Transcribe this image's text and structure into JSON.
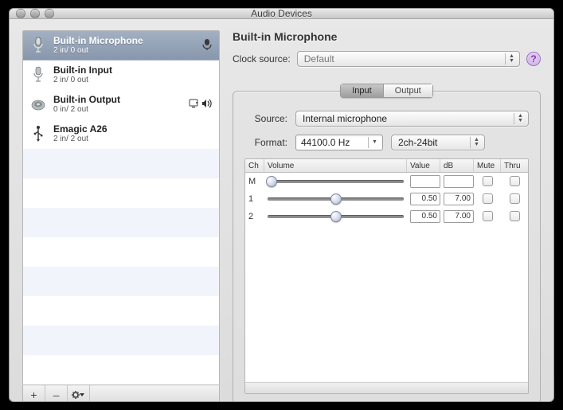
{
  "window": {
    "title": "Audio Devices"
  },
  "sidebar": {
    "devices": [
      {
        "name": "Built-in Microphone",
        "sub": "2 in/ 0 out",
        "icon": "mic",
        "selected": true,
        "badges": [
          "mic"
        ]
      },
      {
        "name": "Built-in Input",
        "sub": "2 in/ 0 out",
        "icon": "mic",
        "selected": false,
        "badges": []
      },
      {
        "name": "Built-in Output",
        "sub": "0 in/ 2 out",
        "icon": "speaker",
        "selected": false,
        "badges": [
          "system",
          "sound"
        ]
      },
      {
        "name": "Emagic A26",
        "sub": "2 in/ 2 out",
        "icon": "usb",
        "selected": false,
        "badges": []
      }
    ],
    "buttons": {
      "add": "+",
      "remove": "–",
      "gear": "✻▾"
    }
  },
  "detail": {
    "title": "Built-in Microphone",
    "clock_label": "Clock source:",
    "clock_value": "Default",
    "tabs": {
      "input": "Input",
      "output": "Output",
      "active": "input"
    },
    "source_label": "Source:",
    "source_value": "Internal microphone",
    "format_label": "Format:",
    "format_hz": "44100.0 Hz",
    "format_chbit": "2ch-24bit",
    "table": {
      "headers": {
        "ch": "Ch",
        "vol": "Volume",
        "val": "Value",
        "db": "dB",
        "mute": "Mute",
        "thru": "Thru"
      },
      "rows": [
        {
          "ch": "M",
          "slider": 0.03,
          "value": "",
          "db": "",
          "mute": false,
          "thru": false
        },
        {
          "ch": "1",
          "slider": 0.5,
          "value": "0.50",
          "db": "7.00",
          "mute": false,
          "thru": false
        },
        {
          "ch": "2",
          "slider": 0.5,
          "value": "0.50",
          "db": "7.00",
          "mute": false,
          "thru": false
        }
      ]
    }
  }
}
